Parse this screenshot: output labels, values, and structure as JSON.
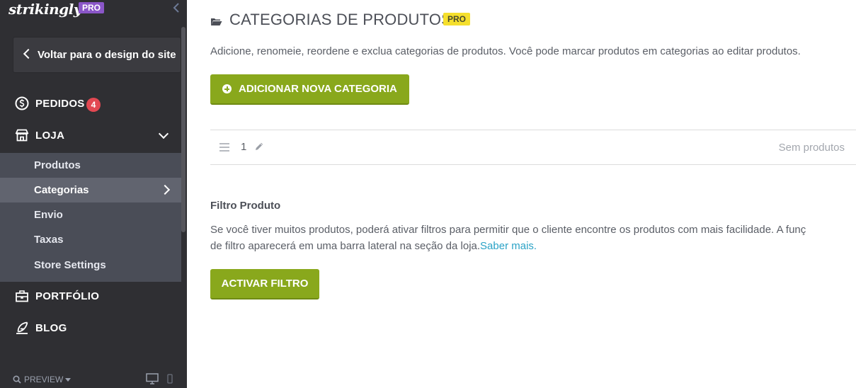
{
  "sidebar": {
    "brand": "strikingly",
    "brand_badge": "PRO",
    "back_label": "Voltar para o design do site",
    "nav": {
      "pedidos": "PEDIDOS",
      "pedidos_count": "4",
      "loja": "LOJA",
      "portfolio": "PORTFÓLIO",
      "blog": "BLOG"
    },
    "loja_items": [
      "Produtos",
      "Categorias",
      "Envio",
      "Taxas",
      "Store Settings"
    ],
    "active_item": "Categorias",
    "preview_label": "PREVIEW"
  },
  "main": {
    "title": "CATEGORIAS DE PRODUTOS",
    "pro_tag": "PRO",
    "description": "Adicione, renomeie, reordene e exclua categorias de produtos. Você pode marcar produtos em categorias ao editar produtos.",
    "add_button": "ADICIONAR NOVA CATEGORIA",
    "categories": [
      {
        "name": "1",
        "status": "Sem produtos"
      }
    ],
    "filter": {
      "heading": "Filtro Produto",
      "text_line1": "Se você tiver muitos produtos, poderá ativar filtros para permitir que o cliente encontre os produtos com mais facilidade. A funç",
      "text_line2": "de filtro aparecerá em uma barra lateral na seção da loja.",
      "link": "Saber mais.",
      "button": "ACTIVAR FILTRO"
    }
  },
  "colors": {
    "sidebar_bg": "#2f2f33",
    "submenu_bg": "#4a4d57",
    "accent_green": "#89a81c",
    "pro_purple": "#8a56c8",
    "pro_yellow": "#f5df2d",
    "badge_red": "#e24852",
    "link_blue": "#2aa2c6"
  },
  "icons": [
    "chevron-left-icon",
    "dollar-circle-icon",
    "store-icon",
    "chevron-down-icon",
    "chevron-right-icon",
    "briefcase-icon",
    "feather-icon",
    "search-icon",
    "desktop-icon",
    "mobile-icon",
    "folder-icon",
    "plus-circle-icon",
    "drag-handle-icon",
    "pencil-icon"
  ]
}
